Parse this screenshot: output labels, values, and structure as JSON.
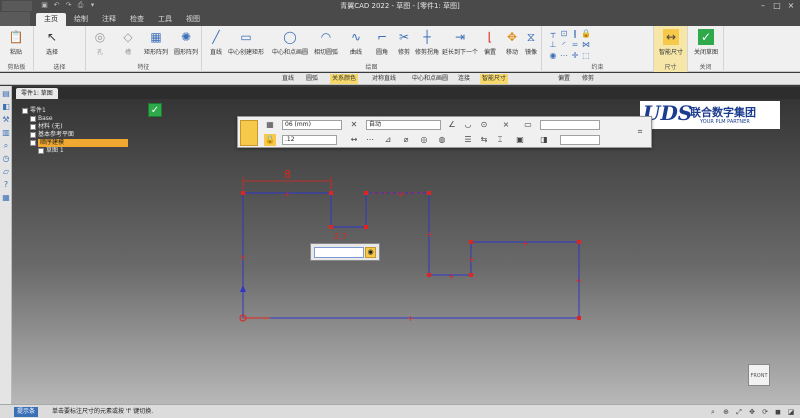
{
  "window": {
    "title": "青翼CAD 2022 - 草图 - [零件1: 草图]"
  },
  "menu_tabs": [
    "主页",
    "绘制",
    "注释",
    "检查",
    "工具",
    "视图"
  ],
  "ribbon": {
    "groups": [
      {
        "label": "剪贴板",
        "buttons": [
          "粘贴"
        ]
      },
      {
        "label": "选择",
        "buttons": [
          "选择"
        ]
      },
      {
        "label": "特征",
        "buttons": [
          "孔",
          "槽",
          "矩形阵列",
          "圆形阵列"
        ]
      },
      {
        "label": "绘图",
        "buttons": [
          "直线",
          "中心创建矩形",
          "中心和点画圆",
          "相切圆弧",
          "曲线",
          "圆角",
          "修剪",
          "修剪拐角",
          "延长到下一个",
          "偏置",
          "移动",
          "镜像"
        ]
      },
      {
        "label": "约束",
        "buttons": []
      },
      {
        "label": "尺寸",
        "buttons": [
          "智能尺寸"
        ]
      },
      {
        "label": "关闭",
        "buttons": [
          "关闭草图"
        ]
      }
    ]
  },
  "selection_bar": {
    "items": [
      "直线",
      "圆弧",
      "关系颜色",
      "对称直线",
      "中心和点画圆",
      "连接",
      "智能尺寸",
      "偏置",
      "修剪"
    ]
  },
  "document_tab": "零件1: 草图",
  "tree": {
    "items": [
      {
        "label": "零件1",
        "level": 0
      },
      {
        "label": "Base",
        "level": 1
      },
      {
        "label": "材料 (无)",
        "level": 1
      },
      {
        "label": "基本参考平面",
        "level": 1
      },
      {
        "label": "顺序建模",
        "level": 1,
        "selected": true
      },
      {
        "label": "草图 1",
        "level": 2
      }
    ]
  },
  "command_bar": {
    "units": "06 (mm)",
    "mode": "自动",
    "precision": ".12"
  },
  "logo": {
    "mark": "UDS",
    "name": "联合数字集团",
    "tagline": "YOUR PLM PARTNER"
  },
  "sketch": {
    "dimension_label": "8",
    "small_label": "2.7",
    "value_input": ""
  },
  "viewcube": {
    "label": "FRONT"
  },
  "status": {
    "badge": "提示条",
    "message": "单击要标注尺寸的元素或按 'f' 键切换."
  },
  "colors": {
    "sketch": "#2d37c8",
    "handle": "#e0241f",
    "accent": "#f6c94a"
  }
}
